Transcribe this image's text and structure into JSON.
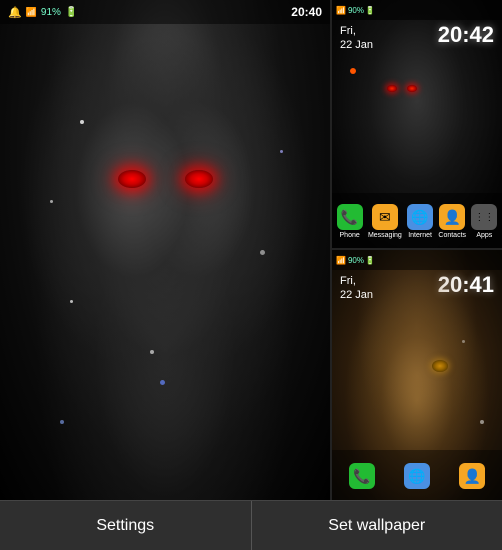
{
  "left_panel": {
    "status_time": "20:40",
    "status_icons": "🔔 📶 91% 🔋"
  },
  "right_top": {
    "date_line1": "Fri,",
    "date_line2": "22 Jan",
    "time": "20:42",
    "status_battery": "90%",
    "dock_icons": [
      {
        "label": "Phone",
        "color": "#22bb33",
        "icon": "📞"
      },
      {
        "label": "Messaging",
        "color": "#f5a623",
        "icon": "✉"
      },
      {
        "label": "Internet",
        "color": "#4a90e2",
        "icon": "🌐"
      },
      {
        "label": "Contacts",
        "color": "#f5a623",
        "icon": "👤"
      },
      {
        "label": "Apps",
        "color": "#555",
        "icon": "⋮⋮⋮"
      }
    ]
  },
  "right_bottom": {
    "date_line1": "Fri,",
    "date_line2": "22 Jan",
    "time": "20:41",
    "status_battery": "90%",
    "dock_icons": [
      {
        "label": "Phone",
        "color": "#22bb33",
        "icon": "📞"
      },
      {
        "label": "Internet",
        "color": "#4a90e2",
        "icon": "🌐"
      },
      {
        "label": "Contacts",
        "color": "#f5a623",
        "icon": "👤"
      }
    ]
  },
  "buttons": {
    "settings_label": "Settings",
    "set_wallpaper_label": "Set wallpaper"
  }
}
